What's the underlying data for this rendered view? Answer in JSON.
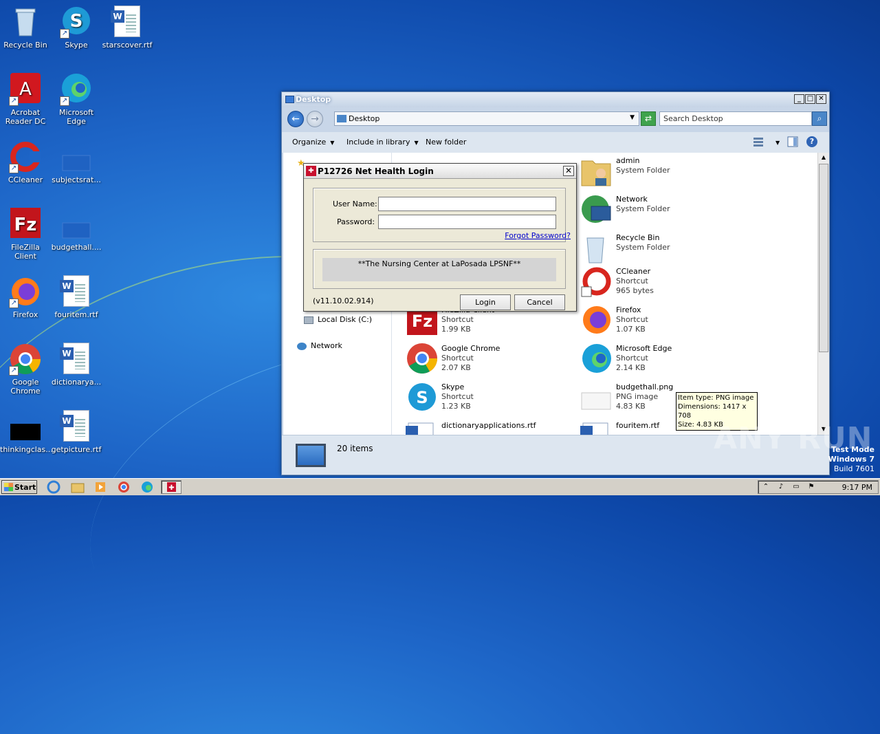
{
  "desktop": {
    "icons": [
      {
        "label": "Recycle Bin",
        "icon": "recycle-bin-icon"
      },
      {
        "label": "Skype",
        "icon": "skype-icon"
      },
      {
        "label": "starscover.rtf",
        "icon": "word-doc-icon"
      },
      {
        "label": "Acrobat Reader DC",
        "icon": "acrobat-icon"
      },
      {
        "label": "Microsoft Edge",
        "icon": "edge-icon"
      },
      {
        "label": "CCleaner",
        "icon": "ccleaner-icon"
      },
      {
        "label": "subjectsrat...",
        "icon": "blank-file-icon"
      },
      {
        "label": "FileZilla Client",
        "icon": "filezilla-icon"
      },
      {
        "label": "budgethall....",
        "icon": "blank-file-icon"
      },
      {
        "label": "Firefox",
        "icon": "firefox-icon"
      },
      {
        "label": "fouritem.rtf",
        "icon": "word-doc-icon"
      },
      {
        "label": "Google Chrome",
        "icon": "chrome-icon"
      },
      {
        "label": "dictionarya...",
        "icon": "word-doc-icon"
      },
      {
        "label": "thinkingclas...",
        "icon": "black-image-icon"
      },
      {
        "label": "getpicture.rtf",
        "icon": "word-doc-icon"
      }
    ]
  },
  "explorer": {
    "title": "Desktop",
    "address": "Desktop",
    "search_placeholder": "Search Desktop",
    "toolbar": {
      "organize": "Organize",
      "include": "Include in library",
      "new_folder": "New folder"
    },
    "nav": {
      "local_disk": "Local Disk (C:)",
      "network": "Network"
    },
    "files": [
      {
        "name": "admin",
        "type": "System Folder",
        "size": ""
      },
      {
        "name": "Network",
        "type": "System Folder",
        "size": ""
      },
      {
        "name": "Recycle Bin",
        "type": "System Folder",
        "size": ""
      },
      {
        "name": "CCleaner",
        "type": "Shortcut",
        "size": "965 bytes"
      },
      {
        "name": "FileZilla Client",
        "type": "Shortcut",
        "size": "1.99 KB"
      },
      {
        "name": "Firefox",
        "type": "Shortcut",
        "size": "1.07 KB"
      },
      {
        "name": "Google Chrome",
        "type": "Shortcut",
        "size": "2.07 KB"
      },
      {
        "name": "Microsoft Edge",
        "type": "Shortcut",
        "size": "2.14 KB"
      },
      {
        "name": "Skype",
        "type": "Shortcut",
        "size": "1.23 KB"
      },
      {
        "name": "budgethall.png",
        "type": "PNG image",
        "size": "4.83 KB"
      },
      {
        "name": "dictionaryapplications.rtf",
        "type": "",
        "size": ""
      },
      {
        "name": "fouritem.rtf",
        "type": "",
        "size": ""
      }
    ],
    "status": "20 items",
    "tooltip": {
      "line1": "Item type: PNG image",
      "line2": "Dimensions: 1417 x 708",
      "line3": "Size: 4.83 KB"
    }
  },
  "login": {
    "title": "P12726 Net Health Login",
    "username_label": "User Name:",
    "password_label": "Password:",
    "username_value": "",
    "password_value": "",
    "forgot": "Forgot Password?",
    "facility": "**The Nursing Center at LaPosada LPSNF**",
    "version": "(v11.10.02.914)",
    "login_button": "Login",
    "cancel_button": "Cancel"
  },
  "taskbar": {
    "start": "Start",
    "clock": "9:17 PM"
  },
  "watermark": {
    "line1": "Test Mode",
    "line2": "Windows 7",
    "line3": "Build 7601",
    "brand": "ANY RUN"
  }
}
